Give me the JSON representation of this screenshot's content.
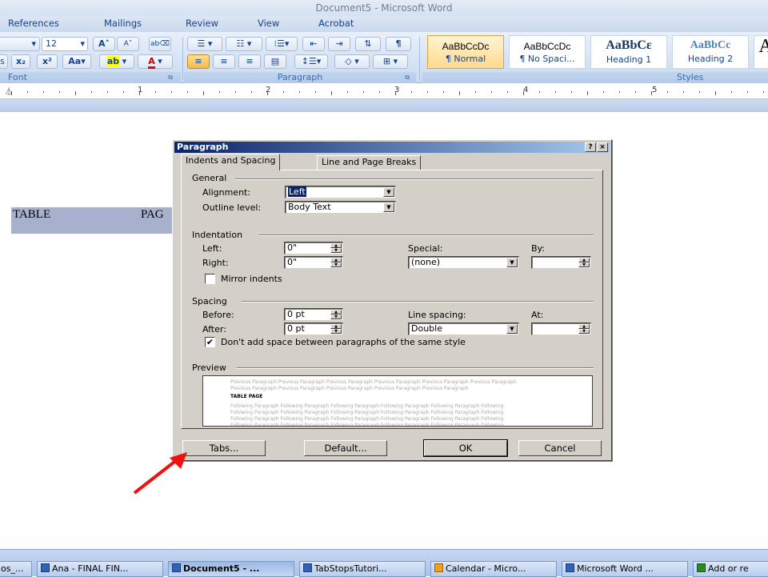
{
  "window": {
    "title": "Document5 - Microsoft Word"
  },
  "ribbon_tabs": [
    "References",
    "Mailings",
    "Review",
    "View",
    "Acrobat"
  ],
  "font_group": {
    "label": "Font",
    "font_size": "12",
    "grow": "A",
    "shrink": "A",
    "subscript": "x₂",
    "superscript": "x²",
    "change_case": "Aa",
    "highlight": "ab",
    "font_color": "A",
    "bold_s": "s"
  },
  "paragraph_group": {
    "label": "Paragraph"
  },
  "styles_group": {
    "label": "Styles",
    "items": [
      {
        "sample": "AaBbCcDc",
        "name": "¶ Normal"
      },
      {
        "sample": "AaBbCcDc",
        "name": "¶ No Spaci..."
      },
      {
        "sample": "AaBbCε",
        "name": "Heading 1"
      },
      {
        "sample": "AaBbCc",
        "name": "Heading 2"
      }
    ],
    "big_a": "A"
  },
  "ruler": {
    "numbers": [
      "1",
      "2",
      "3",
      "4",
      "5"
    ]
  },
  "document": {
    "word1": "TABLE",
    "word2": "PAG"
  },
  "dialog": {
    "title": "Paragraph",
    "help_btn": "?",
    "close_btn": "×",
    "tabs": [
      "Indents and Spacing",
      "Line and Page Breaks"
    ],
    "general": {
      "label": "General",
      "alignment_label": "Alignment:",
      "alignment_value": "Left",
      "outline_label": "Outline level:",
      "outline_value": "Body Text"
    },
    "indentation": {
      "label": "Indentation",
      "left_label": "Left:",
      "left_value": "0\"",
      "right_label": "Right:",
      "right_value": "0\"",
      "special_label": "Special:",
      "special_value": "(none)",
      "by_label": "By:",
      "by_value": "",
      "mirror_label": "Mirror indents",
      "mirror_checked": false
    },
    "spacing": {
      "label": "Spacing",
      "before_label": "Before:",
      "before_value": "0 pt",
      "after_label": "After:",
      "after_value": "0 pt",
      "line_label": "Line spacing:",
      "line_value": "Double",
      "at_label": "At:",
      "at_value": "",
      "dont_add_label": "Don't add space between paragraphs of the same style",
      "dont_add_checked": true,
      "check_mark": "✔"
    },
    "preview": {
      "label": "Preview",
      "prev1": "Previous Paragraph Previous Paragraph Previous Paragraph Previous Paragraph Previous Paragraph Previous Paragraph",
      "prev2": "Previous Paragraph Previous Paragraph Previous Paragraph Previous Paragraph Previous Paragraph",
      "sample": "TABLE    PAGE",
      "next": "Following Paragraph Following Paragraph Following Paragraph Following Paragraph Following Paragraph Following"
    },
    "buttons": {
      "tabs": "Tabs...",
      "default": "Default...",
      "ok": "OK",
      "cancel": "Cancel"
    }
  },
  "taskbar": [
    "os_...",
    "Ana - FINAL FIN...",
    "Document5 - ...",
    "TabStopsTutori...",
    "Calendar - Micro...",
    "Microsoft Word ...",
    "Add or re"
  ],
  "colors": {
    "highlight": "#a7b1cd",
    "dialog_bg": "#d4d0c8",
    "arrow": "#ee1111",
    "title_grad_start": "#0a246a"
  }
}
